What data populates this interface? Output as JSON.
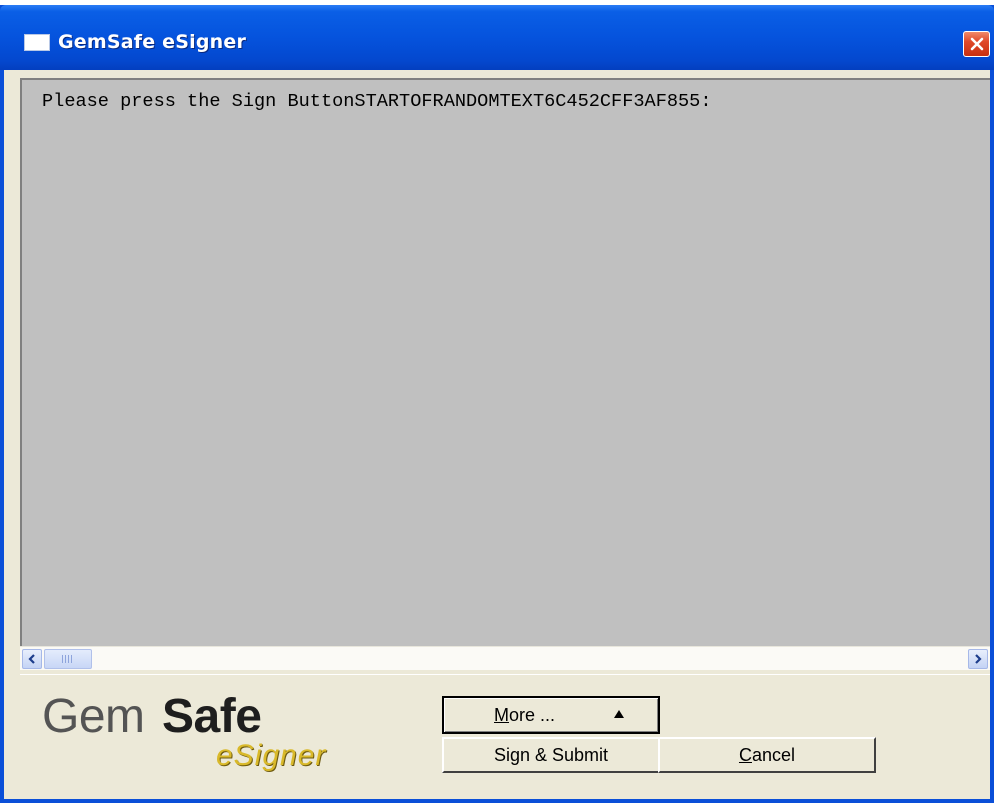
{
  "window": {
    "title": "GemSafe eSigner"
  },
  "message": {
    "text": "Please press the Sign ButtonSTARTOFRANDOMTEXT6C452CFF3AF855:"
  },
  "logo": {
    "gem": "Gem",
    "safe": "Safe",
    "esigner": "eSigner"
  },
  "buttons": {
    "more_mnemonic": "M",
    "more_rest": "ore ...",
    "sign_submit": "Sign & Submit",
    "cancel_mnemonic": "C",
    "cancel_rest": "ancel"
  },
  "colors": {
    "titlebar": "#0553dd",
    "close": "#e0492a",
    "pane": "#c0c0c0",
    "face": "#ece9d8",
    "logo_accent": "#d9b92a"
  },
  "icons": [
    "window-icon",
    "close-icon",
    "scroll-left-icon",
    "scroll-right-icon",
    "more-arrow-icon"
  ]
}
